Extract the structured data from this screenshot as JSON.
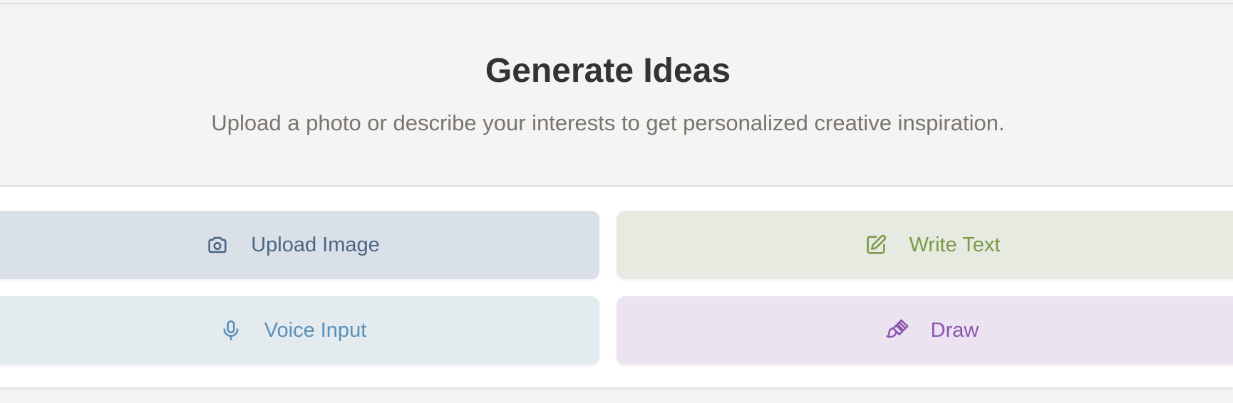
{
  "header": {
    "title": "Generate Ideas",
    "subtitle": "Upload a photo or describe your interests to get personalized creative inspiration."
  },
  "options": [
    {
      "id": "upload",
      "label": "Upload Image",
      "icon": "camera-icon",
      "bg": "#d9e0e8",
      "color": "#4e6584"
    },
    {
      "id": "write",
      "label": "Write Text",
      "icon": "edit-icon",
      "bg": "#e7eae1",
      "color": "#7a9a48"
    },
    {
      "id": "voice",
      "label": "Voice Input",
      "icon": "microphone-icon",
      "bg": "#e3ebef",
      "color": "#5a90b8"
    },
    {
      "id": "draw",
      "label": "Draw",
      "icon": "paintbrush-icon",
      "bg": "#ebe3ef",
      "color": "#8e55b0"
    }
  ]
}
